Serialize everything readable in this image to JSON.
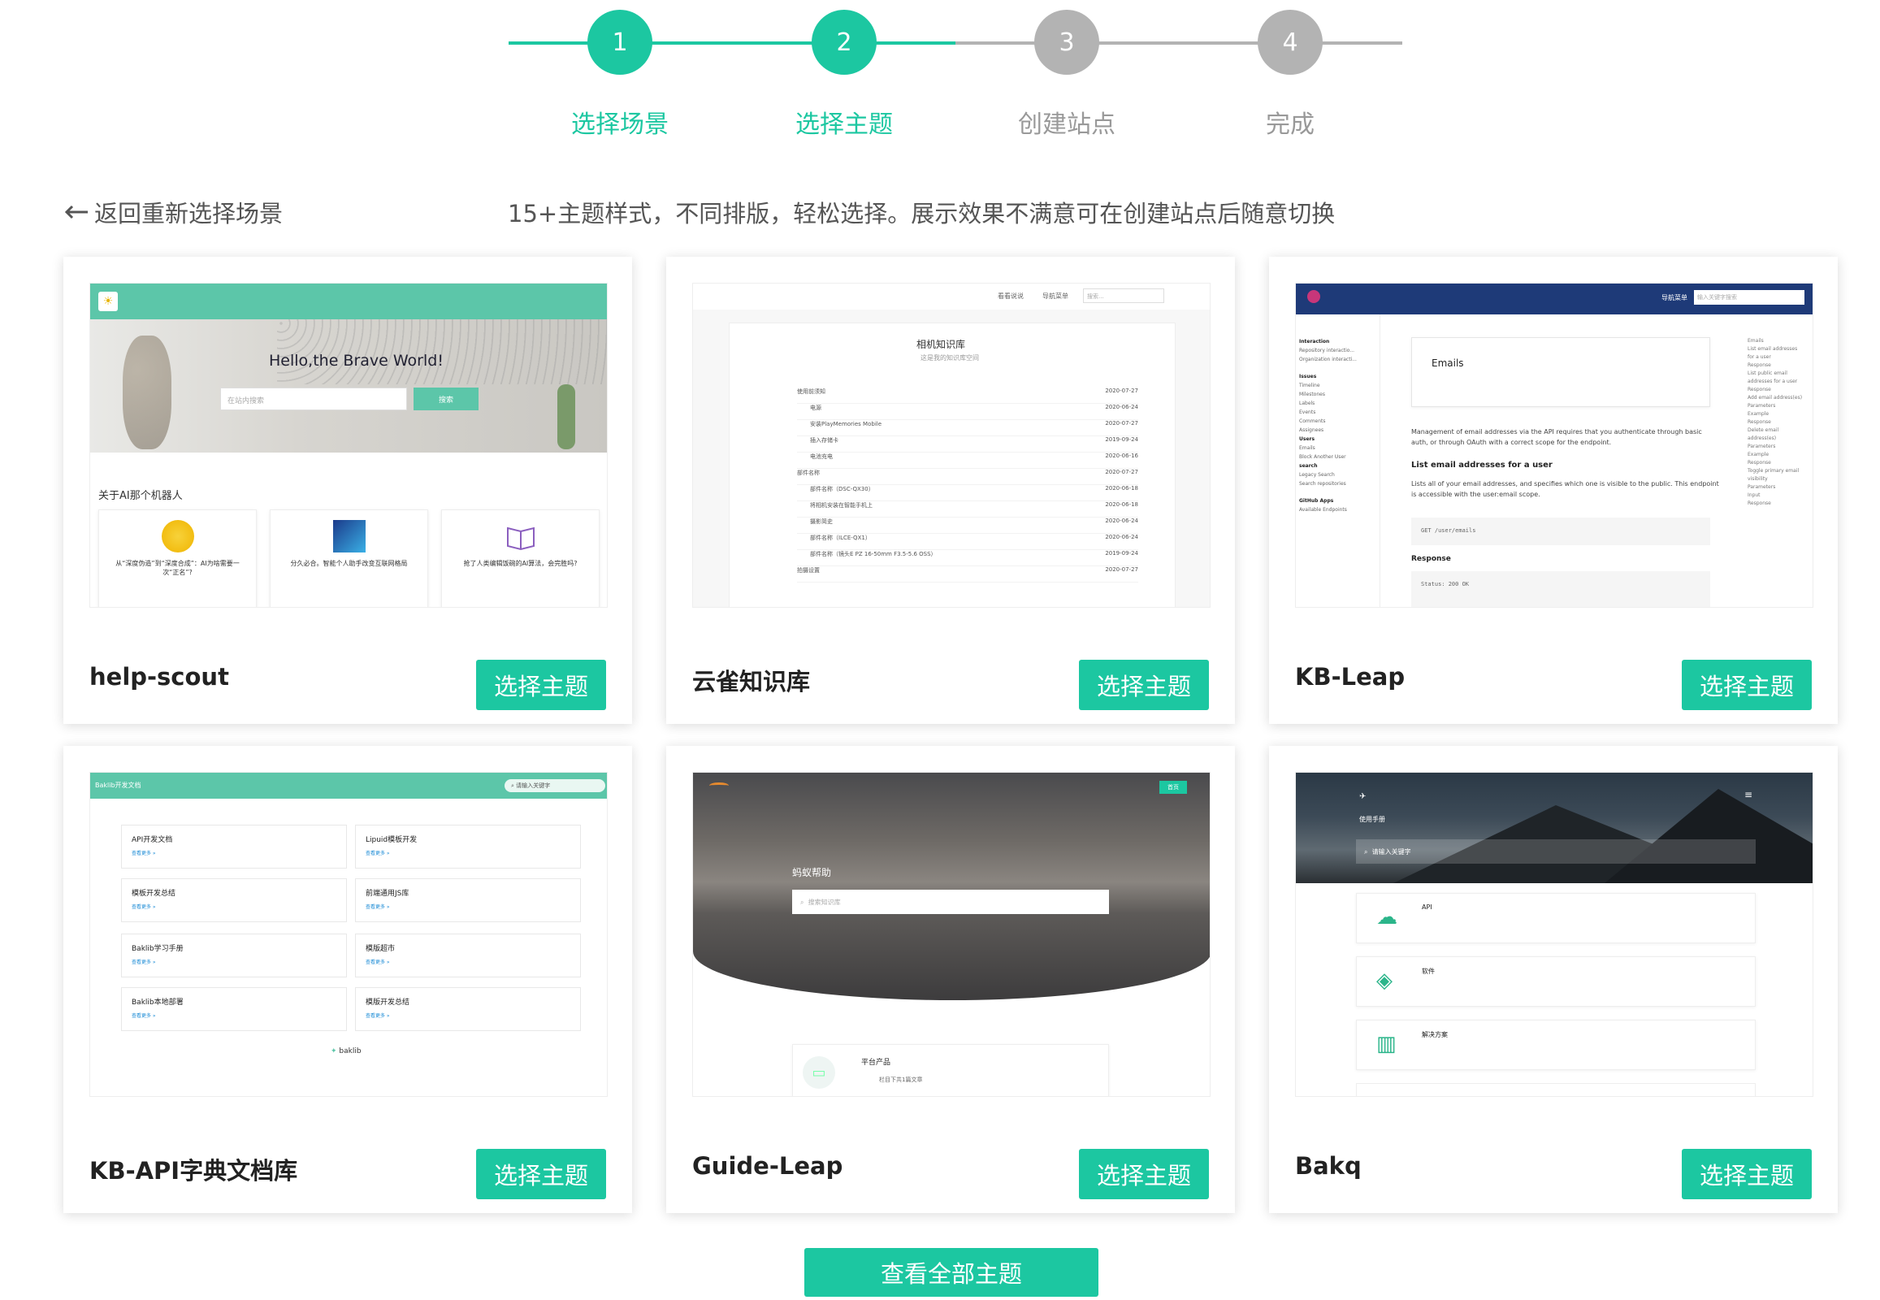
{
  "colors": {
    "accent": "#1cc7a1",
    "inactive": "#b3b3b3"
  },
  "steps": [
    {
      "num": "1",
      "label": "选择场景",
      "state": "done"
    },
    {
      "num": "2",
      "label": "选择主题",
      "state": "active"
    },
    {
      "num": "3",
      "label": "创建站点",
      "state": "todo"
    },
    {
      "num": "4",
      "label": "完成",
      "state": "todo"
    }
  ],
  "back_label": "返回重新选择场景",
  "subtitle": "15+主题样式，不同排版，轻松选择。展示效果不满意可在创建站点后随意切换",
  "select_label": "选择主题",
  "themes": [
    {
      "name": "help-scout"
    },
    {
      "name": "云雀知识库"
    },
    {
      "name": "KB-Leap"
    },
    {
      "name": "KB-API字典文档库"
    },
    {
      "name": "Guide-Leap"
    },
    {
      "name": "Bakq"
    }
  ],
  "previews": {
    "hs": {
      "hero": "Hello,the Brave World!",
      "search_ph": "在站内搜索",
      "search_btn": "搜索",
      "section": "关于AI那个机器人",
      "cards": [
        "从“深度伪造”到“深度合成”：AI为啥需要一次“正名”?",
        "分久必合。智能个人助手改变互联网格局",
        "抢了人类编辑饭碗的AI算法，会完胜吗?"
      ]
    },
    "yq": {
      "nav1": "看看说说",
      "nav2": "导航菜单",
      "search": "搜索...",
      "title": "相机知识库",
      "sub": "这是我的知识库空间",
      "rows": [
        [
          "使用前须知",
          "2020-07-27"
        ],
        [
          "电源",
          "2020-06-24"
        ],
        [
          "安装PlayMemories Mobile",
          "2020-07-27"
        ],
        [
          "插入存储卡",
          "2019-09-24"
        ],
        [
          "电池充电",
          "2020-06-16"
        ],
        [
          "部件名称",
          "2020-07-27"
        ],
        [
          "部件名称（DSC-QX30）",
          "2020-06-18"
        ],
        [
          "将相机安装在智能手机上",
          "2020-06-18"
        ],
        [
          "摄影简史",
          "2020-06-24"
        ],
        [
          "部件名称（ILCE-QX1）",
          "2020-06-24"
        ],
        [
          "部件名称（镜头E PZ 16-50mm F3.5-5.6 OSS）",
          "2019-09-24"
        ],
        [
          "拍摄设置",
          "2020-07-27"
        ]
      ]
    },
    "kb": {
      "nav": "导航菜单",
      "search_ph": "输入关键字搜索",
      "side": [
        "Interaction",
        "Repository interactio...",
        "Organization interacti...",
        "Issues",
        "Timeline",
        "Milestones",
        "Labels",
        "Events",
        "Comments",
        "Assignees",
        "Users",
        "Emails",
        "Block Another User",
        "search",
        "Legacy Search",
        "Search repositories",
        "GitHub Apps",
        "Available Endpoints"
      ],
      "h1": "Emails",
      "p1": "Management of email addresses via the API requires that you authenticate through basic auth, or through OAuth with a correct scope for the endpoint.",
      "h2": "List email addresses for a user",
      "p2": "Lists all of your email addresses, and specifies which one is visible to the public. This endpoint is accessible with the user:email scope.",
      "code": "GET /user/emails",
      "h3": "Response",
      "code2": "Status: 200 OK",
      "toc": [
        "Emails",
        "List email addresses for a user",
        "Response",
        "List public email addresses for a user",
        "Response",
        "Add email address(es)",
        "Parameters",
        "Example",
        "Response",
        "Delete email address(es)",
        "Parameters",
        "Example",
        "Response",
        "Toggle primary email visibility",
        "Parameters",
        "Input",
        "Response"
      ]
    },
    "api": {
      "brand": "Baklib开发文档",
      "search_ph": "请输入关键字",
      "more": "查看更多 »",
      "items": [
        "API开发文档",
        "Lipuid模板开发",
        "模板开发总结",
        "前端通用JS库",
        "Baklib学习手册",
        "模版超市",
        "Baklib本地部署",
        "模版开发总结"
      ],
      "logo": "baklib"
    },
    "gl": {
      "home": "首页",
      "title": "蚂蚁帮助",
      "search_ph": "搜索知识库",
      "item": "平台产品",
      "meta": "栏目下共1篇文章"
    },
    "bq": {
      "title": "使用手册",
      "search_ph": "请输入关键字",
      "items": [
        "API",
        "软件",
        "解决方案"
      ]
    }
  },
  "all_label": "查看全部主题"
}
